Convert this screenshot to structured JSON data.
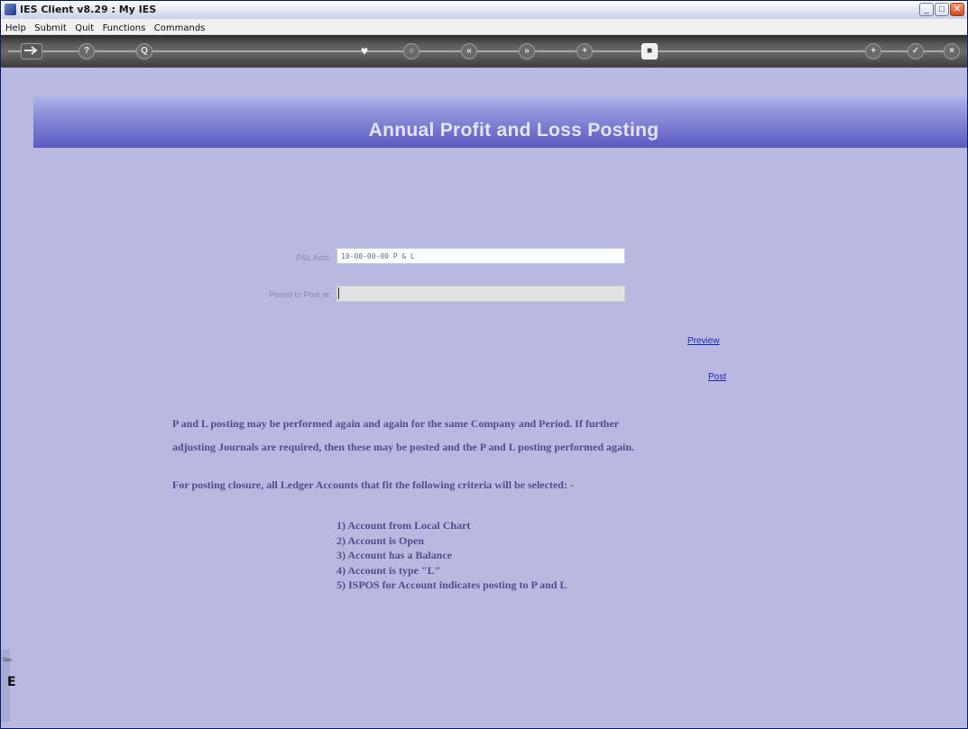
{
  "window": {
    "title": "IES Client v8.29 : My IES",
    "controls": [
      "_",
      "□",
      "✕"
    ]
  },
  "menu": [
    "Help",
    "Submit",
    "Quit",
    "Functions",
    "Commands"
  ],
  "toolbar": {
    "icons": [
      "exit-arrow-icon",
      "help-icon",
      "search-icon",
      "favorite-heart-icon",
      "refresh-icon",
      "previous-icon",
      "next-icon",
      "options-icon",
      "bookmark-icon",
      "new-icon",
      "confirm-icon",
      "close-icon"
    ],
    "glyphs": {
      "help": "?",
      "search": "Q",
      "heart": "♥",
      "refresh": "○",
      "prev": "«",
      "next": "»",
      "options": "+",
      "bookmark": "■",
      "new": "+",
      "confirm": "✓",
      "close": "×"
    }
  },
  "banner": {
    "title": "Annual Profit and Loss Posting"
  },
  "form": {
    "acct_label": "P&L Acct:",
    "acct_value": "10-00-00-00 P & L",
    "period_label": "Period to Post at:",
    "period_value": ""
  },
  "actions": {
    "preview": "Preview",
    "post": "Post"
  },
  "notes": {
    "line1": "P and L posting may be performed  again and again for the same   Company and Period. If further",
    "line2": "adjusting Journals are required, then these may be posted and the P and L posting performed again.",
    "line3": "For posting closure, all Ledger Accounts that fit the following criteria will be selected: -"
  },
  "criteria": [
    "1) Account from Local Chart",
    "2) Account is Open",
    "3) Account has a Balance",
    "4) Account is type \"L\"",
    "5) ISPOS for Account indicates posting to P and L"
  ],
  "side": {
    "letter": "E",
    "mini": "Sec"
  },
  "colors": {
    "banner_dark": "#5a5ac0",
    "background": "#b8b8e0",
    "text": "#4f4f8a",
    "link": "#1a2ab0"
  }
}
